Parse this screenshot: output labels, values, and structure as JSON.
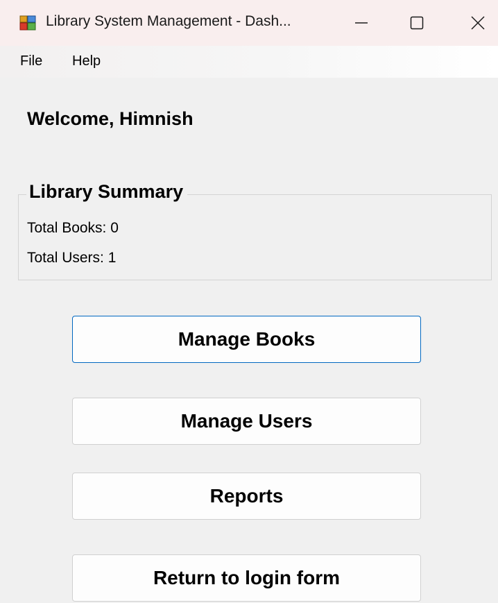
{
  "window": {
    "title": "Library System Management - Dash...",
    "accent_color": "#0067c0",
    "titlebar_color": "#f9eeee",
    "controls": {
      "minimize_icon": "minimize-icon",
      "maximize_icon": "maximize-icon",
      "close_icon": "close-icon"
    }
  },
  "menu": {
    "items": [
      "File",
      "Help"
    ]
  },
  "dashboard": {
    "welcome": "Welcome, Himnish",
    "summary": {
      "title": "Library Summary",
      "total_books": "Total Books: 0",
      "total_users": "Total Users: 1"
    },
    "buttons": {
      "manage_books": "Manage Books",
      "manage_users": "Manage Users",
      "reports": "Reports",
      "return_login": "Return to login form"
    }
  }
}
